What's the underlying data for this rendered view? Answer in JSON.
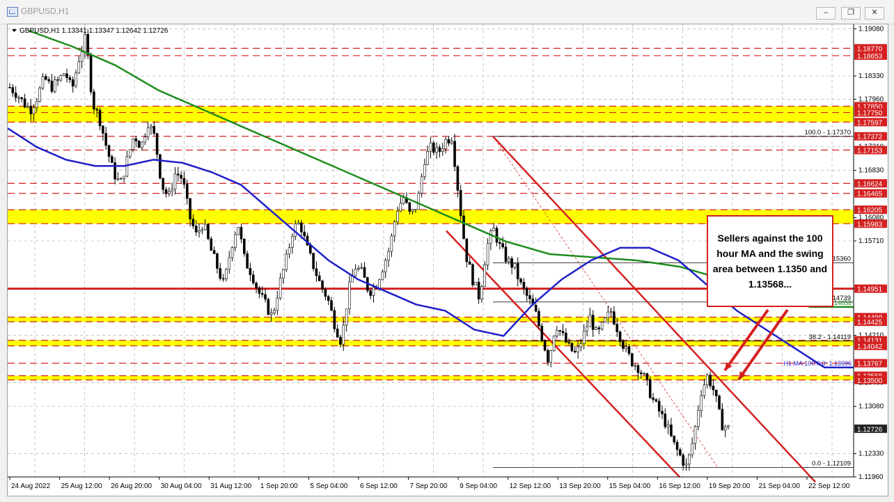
{
  "window": {
    "title": "GBPUSD,H1",
    "controls": [
      "minimize",
      "restore",
      "close"
    ]
  },
  "chart_info": {
    "symbol_line": "GBPUSD,H1  1.13341 1.13347 1.12642 1.12726"
  },
  "chart_data": {
    "type": "candlestick",
    "symbol": "GBPUSD",
    "timeframe": "H1",
    "ylim": [
      1.1196,
      1.1915
    ],
    "price_ticks": [
      "1.19080",
      "1.18330",
      "1.17960",
      "1.17210",
      "1.16830",
      "1.16080",
      "1.15710",
      "1.14960",
      "1.14210",
      "1.13460",
      "1.13080",
      "1.12330",
      "1.11960"
    ],
    "time_labels": [
      "24 Aug 2022",
      "25 Aug 12:00",
      "26 Aug 20:00",
      "30 Aug 04:00",
      "31 Aug 12:00",
      "1 Sep 20:00",
      "5 Sep 04:00",
      "6 Sep 12:00",
      "7 Sep 20:00",
      "9 Sep 04:00",
      "12 Sep 12:00",
      "13 Sep 20:00",
      "15 Sep 04:00",
      "16 Sep 12:00",
      "19 Sep 20:00",
      "21 Sep 04:00",
      "22 Sep 12:00"
    ],
    "price_path": [
      1.1815,
      1.1805,
      1.179,
      1.178,
      1.18,
      1.183,
      1.1815,
      1.1825,
      1.184,
      1.181,
      1.186,
      1.1895,
      1.179,
      1.1765,
      1.172,
      1.168,
      1.166,
      1.17,
      1.174,
      1.172,
      1.176,
      1.1735,
      1.166,
      1.164,
      1.168,
      1.167,
      1.161,
      1.158,
      1.16,
      1.156,
      1.153,
      1.15,
      1.156,
      1.16,
      1.154,
      1.152,
      1.149,
      1.147,
      1.145,
      1.15,
      1.154,
      1.159,
      1.16,
      1.156,
      1.153,
      1.15,
      1.148,
      1.144,
      1.141,
      1.149,
      1.153,
      1.152,
      1.149,
      1.15,
      1.153,
      1.156,
      1.162,
      1.164,
      1.161,
      1.163,
      1.17,
      1.172,
      1.171,
      1.173,
      1.1737,
      1.164,
      1.155,
      1.151,
      1.148,
      1.156,
      1.159,
      1.156,
      1.154,
      1.153,
      1.15,
      1.148,
      1.146,
      1.142,
      1.138,
      1.144,
      1.142,
      1.14,
      1.139,
      1.142,
      1.145,
      1.142,
      1.144,
      1.146,
      1.143,
      1.14,
      1.138,
      1.137,
      1.135,
      1.132,
      1.13,
      1.128,
      1.125,
      1.123,
      1.1211,
      1.126,
      1.133,
      1.1357,
      1.133,
      1.128,
      1.1273
    ],
    "ma100": [
      1.175,
      1.172,
      1.17,
      1.169,
      1.169,
      1.17,
      1.1695,
      1.168,
      1.166,
      1.162,
      1.158,
      1.154,
      1.151,
      1.149,
      1.147,
      1.146,
      1.143,
      1.142,
      1.147,
      1.151,
      1.154,
      1.156,
      1.156,
      1.154,
      1.15,
      1.146,
      1.143,
      1.14,
      1.137,
      1.137
    ],
    "ma200": [
      1.1905,
      1.188,
      1.185,
      1.181,
      1.178,
      1.175,
      1.172,
      1.169,
      1.166,
      1.163,
      1.16,
      1.157,
      1.155,
      1.1545,
      1.154,
      1.153,
      1.151,
      1.149,
      1.1466,
      1.1466
    ],
    "series": [
      {
        "name": "H1 MA:100:0:0: 1.13696",
        "color": "#1f1fc8"
      },
      {
        "name": "H1 MA:200:0:0: 1.14658",
        "color": "#1e8c1e"
      }
    ],
    "horizontal_levels": [
      {
        "label": "1.18770",
        "color": "#d42020"
      },
      {
        "label": "1.18653",
        "color": "#d42020"
      },
      {
        "label": "1.17850",
        "color": "#d42020"
      },
      {
        "label": "1.17750",
        "color": "#d42020"
      },
      {
        "label": "1.17597",
        "color": "#d42020"
      },
      {
        "label": "1.17372",
        "color": "#d42020"
      },
      {
        "label": "1.17153",
        "color": "#d42020"
      },
      {
        "label": "1.16624",
        "color": "#d42020"
      },
      {
        "label": "1.16465",
        "color": "#d42020"
      },
      {
        "label": "1.16205",
        "color": "#d42020"
      },
      {
        "label": "1.15983",
        "color": "#d42020"
      },
      {
        "label": "1.14951",
        "color": "#d42020"
      },
      {
        "label": "1.14499",
        "color": "#d42020"
      },
      {
        "label": "1.14425",
        "color": "#d42020"
      },
      {
        "label": "1.14131",
        "color": "#d42020"
      },
      {
        "label": "1.14042",
        "color": "#d42020"
      },
      {
        "label": "1.13767",
        "color": "#d42020"
      },
      {
        "label": "1.13568",
        "color": "#d42020"
      },
      {
        "label": "1.13500",
        "color": "#d42020"
      },
      {
        "label": "1.12726",
        "color": "#222222"
      }
    ],
    "fib_labels": [
      "100.0 - 1.17370",
      "1.15360",
      "1.14739",
      "38.2 - 1.14119",
      "0.0 - 1.12109"
    ]
  },
  "annotation": {
    "callout_text": "Sellers against the 100 hour MA and the swing area between 1.1350 and 1.13568..."
  },
  "colors": {
    "yellow_band": "#ffff00",
    "red_line": "#d42020",
    "candle": "#000000",
    "ma100": "#1f1fc8",
    "ma200": "#1e8c1e"
  }
}
